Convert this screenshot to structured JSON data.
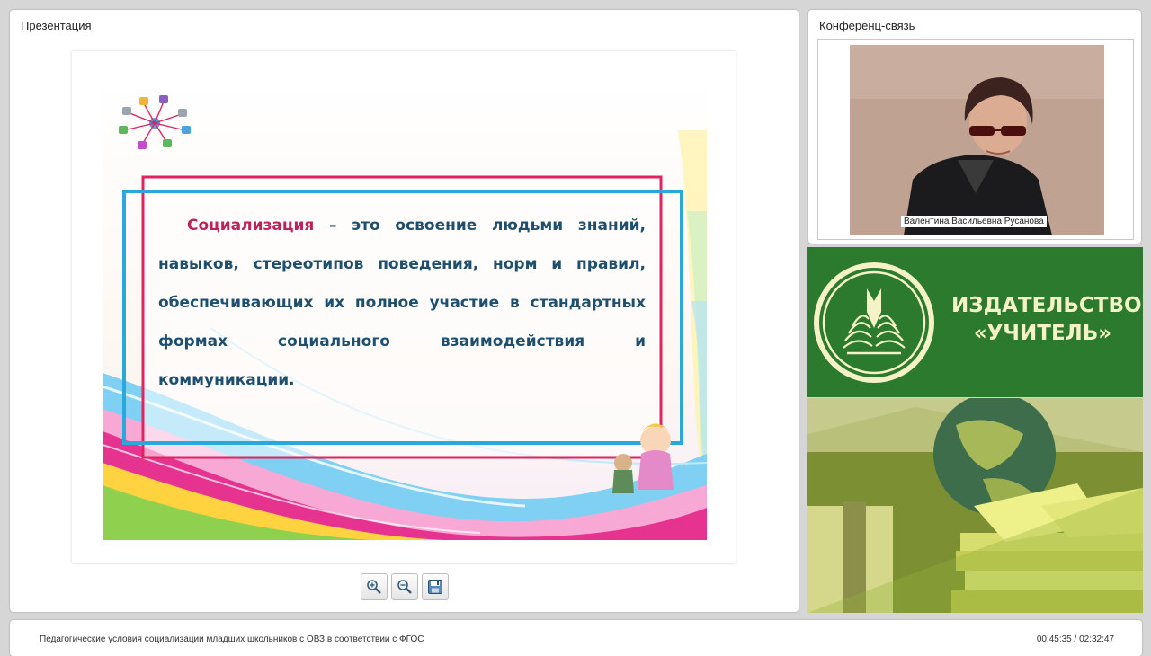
{
  "presentation": {
    "title": "Презентация",
    "slide": {
      "term": "Социализация",
      "definition": " – это освоение людьми знаний, навыков, стереотипов поведения, норм и правил, обеспечивающих их полное участие в стандартных формах социального взаимодействия и коммуникации."
    },
    "toolbar": {
      "zoom_in_icon": "zoom-in-icon",
      "zoom_out_icon": "zoom-out-icon",
      "save_icon": "save-icon"
    }
  },
  "conference": {
    "title": "Конференц-связь",
    "speaker_name": "Валентина Васильевна Русанова"
  },
  "publisher": {
    "name_line1": "ИЗДАТЕЛЬСТВО",
    "name_line2": "«УЧИТЕЛЬ»",
    "colors": {
      "green": "#2c7a2e",
      "text": "#f4f2c6"
    }
  },
  "footer": {
    "title": "Педагогические условия социализации младших школьников с ОВЗ в соответствии с ФГОС",
    "time": "00:45:35 / 02:32:47"
  }
}
